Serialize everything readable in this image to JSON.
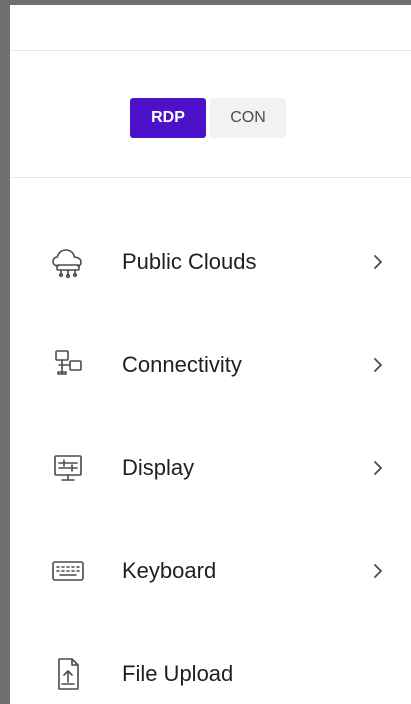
{
  "mode_toggle": {
    "rdp": "RDP",
    "con": "CON",
    "active": "RDP"
  },
  "menu": {
    "items": [
      {
        "label": "Public Clouds",
        "icon": "cloud-icon",
        "has_submenu": true
      },
      {
        "label": "Connectivity",
        "icon": "connectivity-icon",
        "has_submenu": true
      },
      {
        "label": "Display",
        "icon": "display-icon",
        "has_submenu": true
      },
      {
        "label": "Keyboard",
        "icon": "keyboard-icon",
        "has_submenu": true
      },
      {
        "label": "File Upload",
        "icon": "file-upload-icon",
        "has_submenu": false
      }
    ]
  },
  "colors": {
    "accent": "#4b12c9",
    "frame": "#6f6f6f",
    "text": "#1f1f1f",
    "icon": "#4b4b4b"
  }
}
